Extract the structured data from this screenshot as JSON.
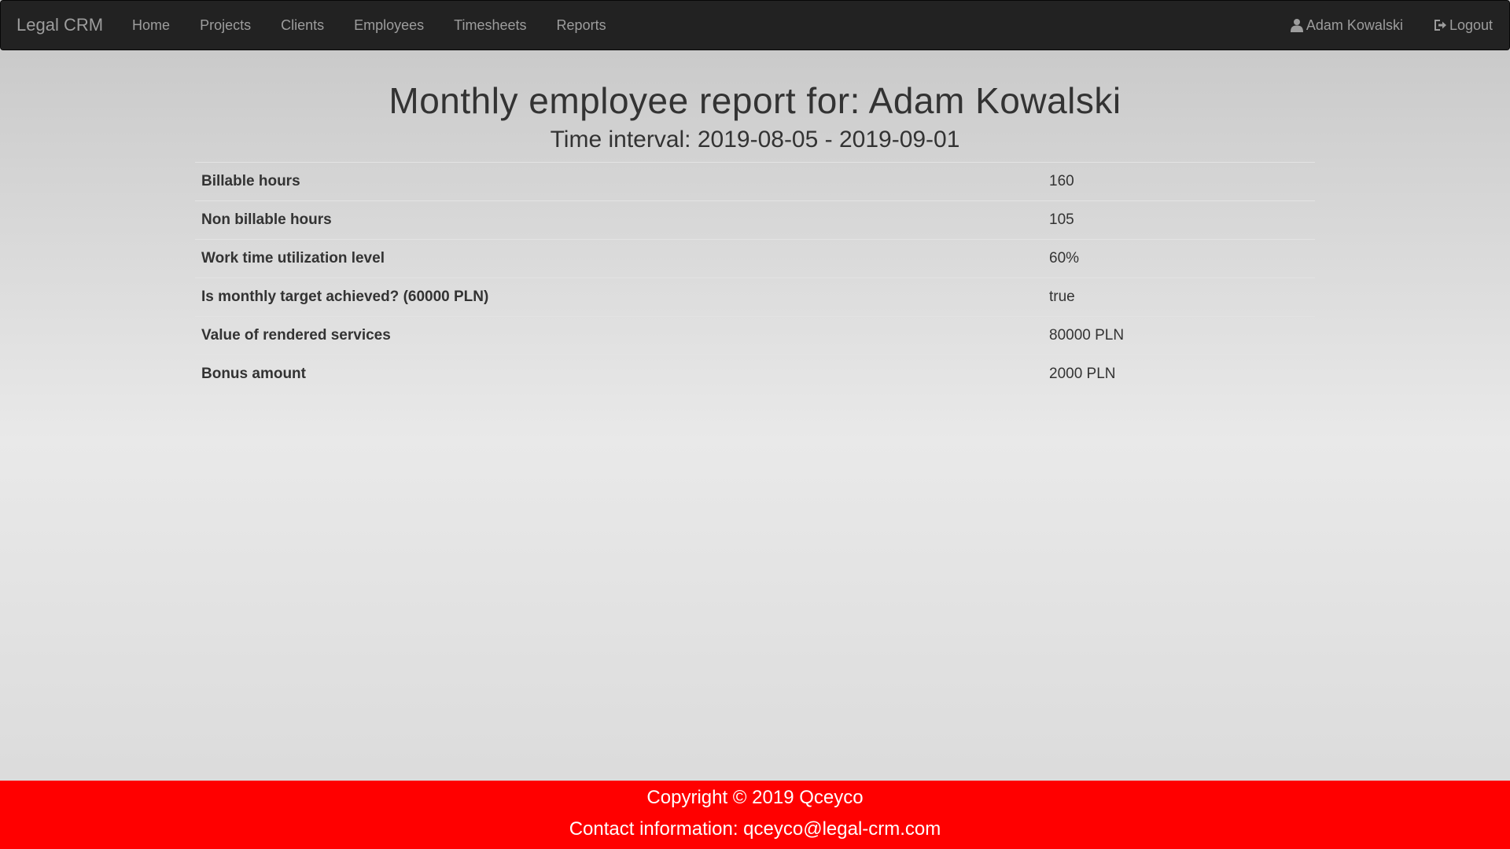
{
  "navbar": {
    "brand": "Legal CRM",
    "links": [
      {
        "label": "Home"
      },
      {
        "label": "Projects"
      },
      {
        "label": "Clients"
      },
      {
        "label": "Employees"
      },
      {
        "label": "Timesheets"
      },
      {
        "label": "Reports"
      }
    ],
    "user": {
      "label": "Adam Kowalski",
      "icon": "user-icon"
    },
    "logout": {
      "label": "Logout",
      "icon": "logout-icon"
    }
  },
  "report": {
    "title": "Monthly employee report for: Adam Kowalski",
    "subtitle": "Time interval: 2019-08-05 - 2019-09-01",
    "rows": [
      {
        "label": "Billable hours",
        "value": "160"
      },
      {
        "label": "Non billable hours",
        "value": "105"
      },
      {
        "label": "Work time utilization level",
        "value": "60%"
      },
      {
        "label": "Is monthly target achieved? (60000 PLN)",
        "value": "true"
      },
      {
        "label": "Value of rendered services",
        "value": "80000 PLN"
      },
      {
        "label": "Bonus amount",
        "value": "2000 PLN"
      }
    ]
  },
  "footer": {
    "copyright": "Copyright © 2019 Qceyco",
    "contact": "Contact information: qceyco@legal-crm.com"
  },
  "colors": {
    "navbar_bg": "#222222",
    "nav_text": "#9d9d9d",
    "footer_bg": "#ff0000",
    "text": "#333333"
  }
}
